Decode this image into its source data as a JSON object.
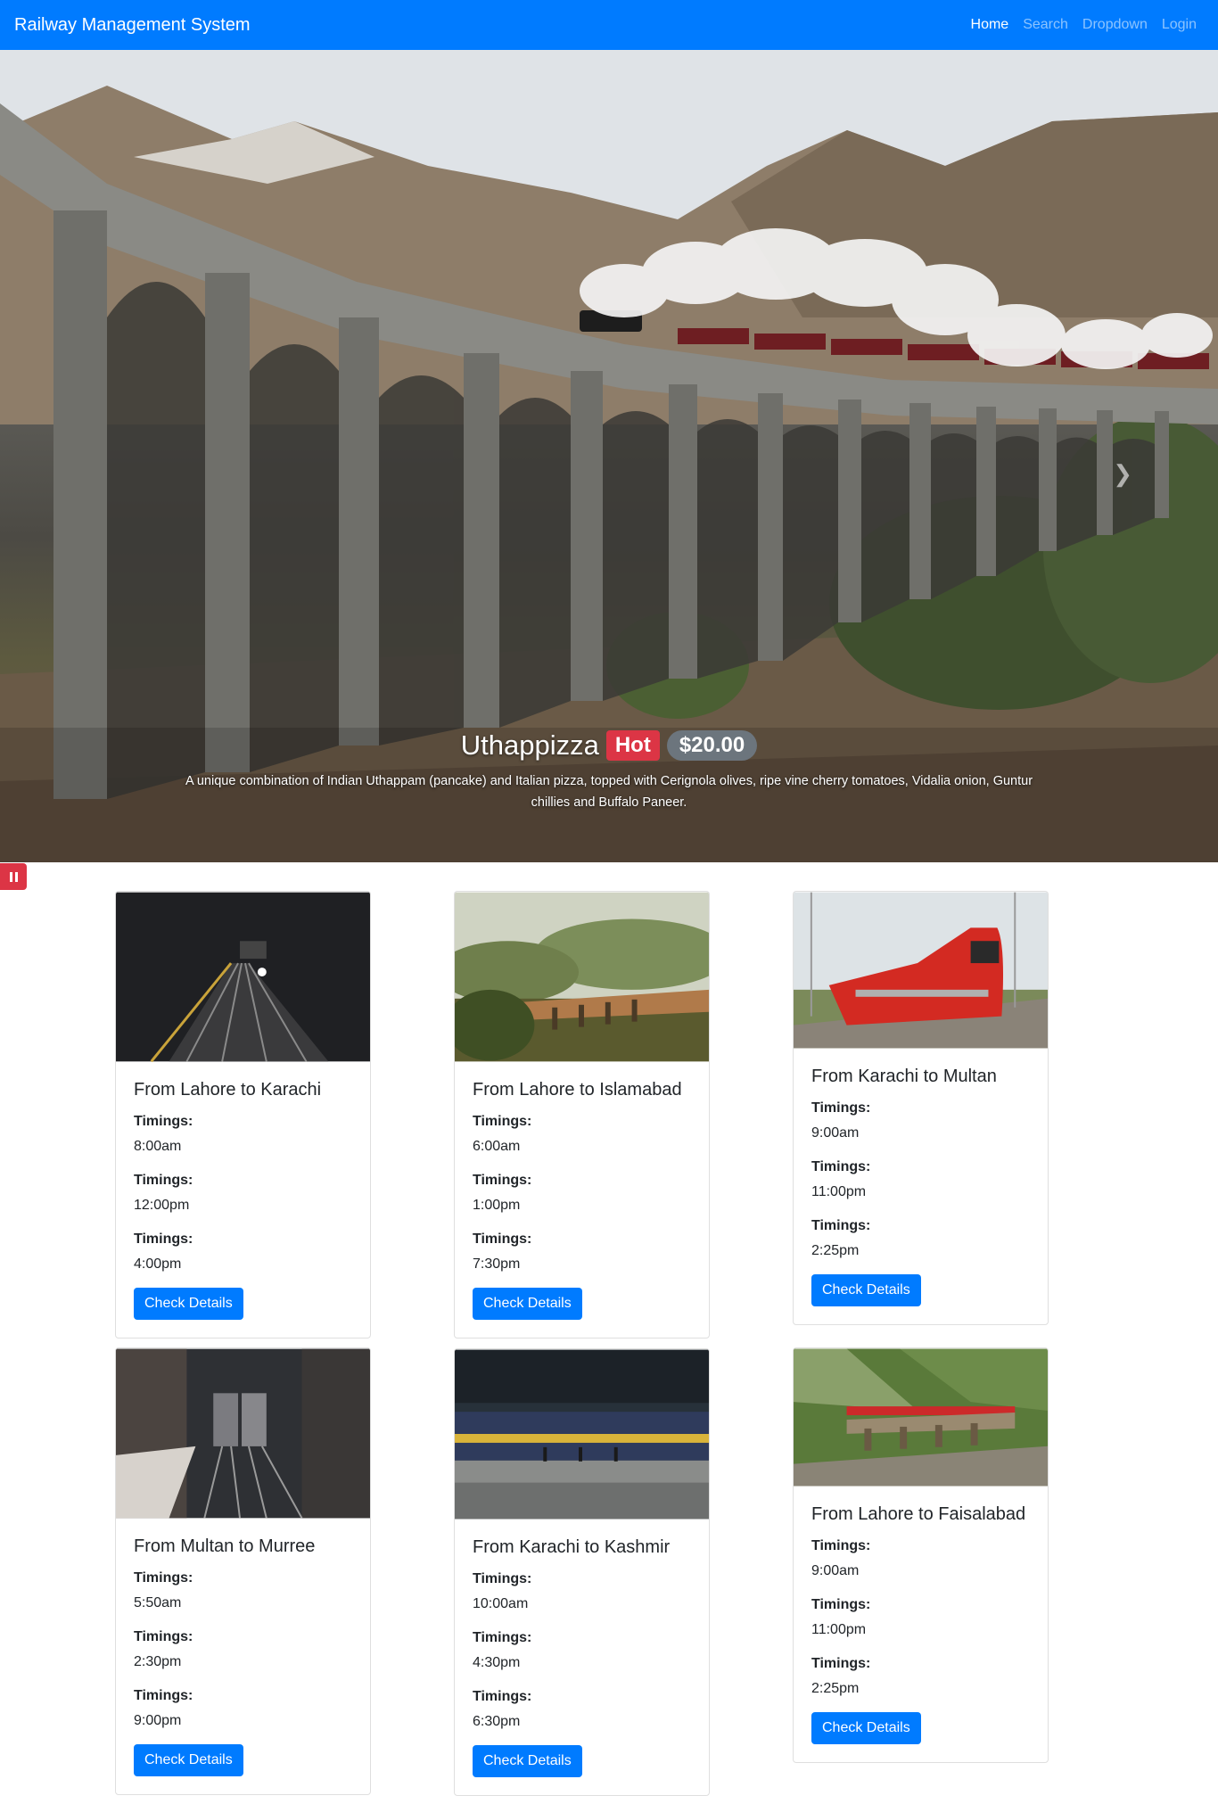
{
  "navbar": {
    "brand": "Railway Management System",
    "links": [
      "Home",
      "Search",
      "Dropdown",
      "Login"
    ],
    "active": "Home"
  },
  "carousel": {
    "title": "Uthappizza",
    "badge_hot": "Hot",
    "badge_price": "$20.00",
    "description": "A unique combination of Indian Uthappam (pancake) and Italian pizza, topped with Cerignola olives, ripe vine cherry tomatoes, Vidalia onion, Guntur chillies and Buffalo Paneer."
  },
  "colors": {
    "primary": "#007bff",
    "danger": "#dc3545",
    "secondary": "#6c757d"
  },
  "cards": [
    {
      "title": "From Lahore to Karachi",
      "timings": [
        "8:00am",
        "12:00pm",
        "4:00pm"
      ],
      "label": "Timings:",
      "button": "Check Details"
    },
    {
      "title": "From Lahore to Islamabad",
      "timings": [
        "6:00am",
        "1:00pm",
        "7:30pm"
      ],
      "label": "Timings:",
      "button": "Check Details"
    },
    {
      "title": "From Karachi to Multan",
      "timings": [
        "9:00am",
        "11:00pm",
        "2:25pm"
      ],
      "label": "Timings:",
      "button": "Check Details"
    },
    {
      "title": "From Multan to Murree",
      "timings": [
        "5:50am",
        "2:30pm",
        "9:00pm"
      ],
      "label": "Timings:",
      "button": "Check Details"
    },
    {
      "title": "From Karachi to Kashmir",
      "timings": [
        "10:00am",
        "4:30pm",
        "6:30pm"
      ],
      "label": "Timings:",
      "button": "Check Details"
    },
    {
      "title": "From Lahore to Faisalabad",
      "timings": [
        "9:00am",
        "11:00pm",
        "2:25pm"
      ],
      "label": "Timings:",
      "button": "Check Details"
    }
  ]
}
